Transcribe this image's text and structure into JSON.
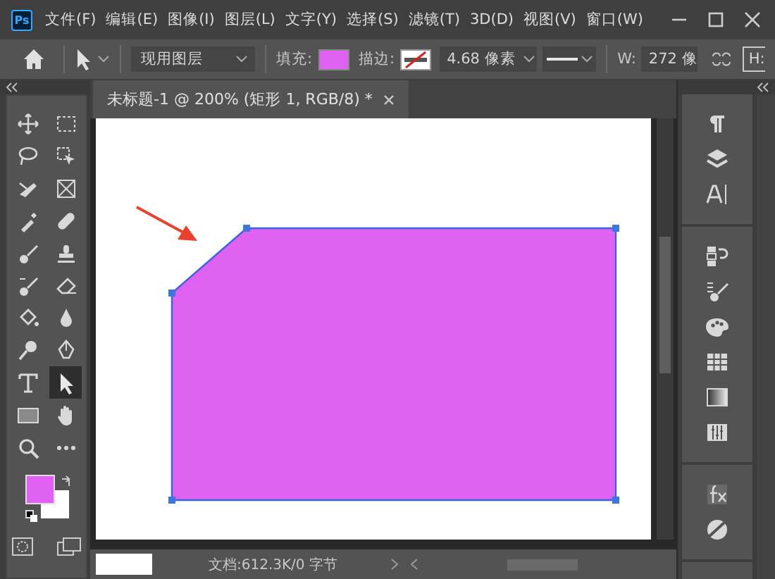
{
  "app": {
    "logo": "Ps"
  },
  "menu": [
    "文件(F)",
    "编辑(E)",
    "图像(I)",
    "图层(L)",
    "文字(Y)",
    "选择(S)",
    "滤镜(T)",
    "3D(D)",
    "视图(V)",
    "窗口(W)"
  ],
  "options": {
    "workspace": "现用图层",
    "fill": {
      "label": "填充:",
      "color": "#e062f2"
    },
    "stroke": {
      "label": "描边:",
      "width": "4.68 像素"
    },
    "w": {
      "label": "W:",
      "value": "272 像"
    },
    "h": {
      "label": "H:"
    }
  },
  "document": {
    "tab": "未标题-1 @ 200% (矩形 1, RGB/8) *"
  },
  "tools": [
    {
      "kind": "move",
      "selected": false
    },
    {
      "kind": "marquee",
      "selected": false
    },
    {
      "kind": "lasso",
      "selected": false
    },
    {
      "kind": "object-select",
      "selected": false
    },
    {
      "kind": "crop",
      "selected": false
    },
    {
      "kind": "frame",
      "selected": false
    },
    {
      "kind": "eyedropper",
      "selected": false
    },
    {
      "kind": "bandage",
      "selected": false
    },
    {
      "kind": "brush",
      "selected": false
    },
    {
      "kind": "stamp",
      "selected": false
    },
    {
      "kind": "history-brush",
      "selected": false
    },
    {
      "kind": "eraser",
      "selected": false
    },
    {
      "kind": "bucket",
      "selected": false
    },
    {
      "kind": "drop",
      "selected": false
    },
    {
      "kind": "dodge",
      "selected": false
    },
    {
      "kind": "pen",
      "selected": false
    },
    {
      "kind": "type",
      "selected": false
    },
    {
      "kind": "pointer",
      "selected": true
    },
    {
      "kind": "rectangle",
      "selected": false
    },
    {
      "kind": "hand",
      "selected": false
    },
    {
      "kind": "zoom",
      "selected": false
    },
    {
      "kind": "more",
      "selected": false
    }
  ],
  "colors": {
    "foreground": {
      "color": "#e062f2"
    },
    "background": {
      "color": "#ffffff"
    }
  },
  "panels": [
    {
      "items": [
        {
          "kind": "paragraph"
        },
        {
          "kind": "layers"
        },
        {
          "kind": "character"
        }
      ]
    },
    {
      "items": [
        {
          "kind": "history"
        },
        {
          "kind": "brush-settings"
        },
        {
          "kind": "palette"
        },
        {
          "kind": "swatches"
        },
        {
          "kind": "gradient"
        },
        {
          "kind": "adjustments"
        }
      ]
    },
    {
      "items": [
        {
          "kind": "fx"
        },
        {
          "kind": "circle"
        }
      ]
    }
  ],
  "status": {
    "info": "文档:612.3K/0 字节"
  }
}
